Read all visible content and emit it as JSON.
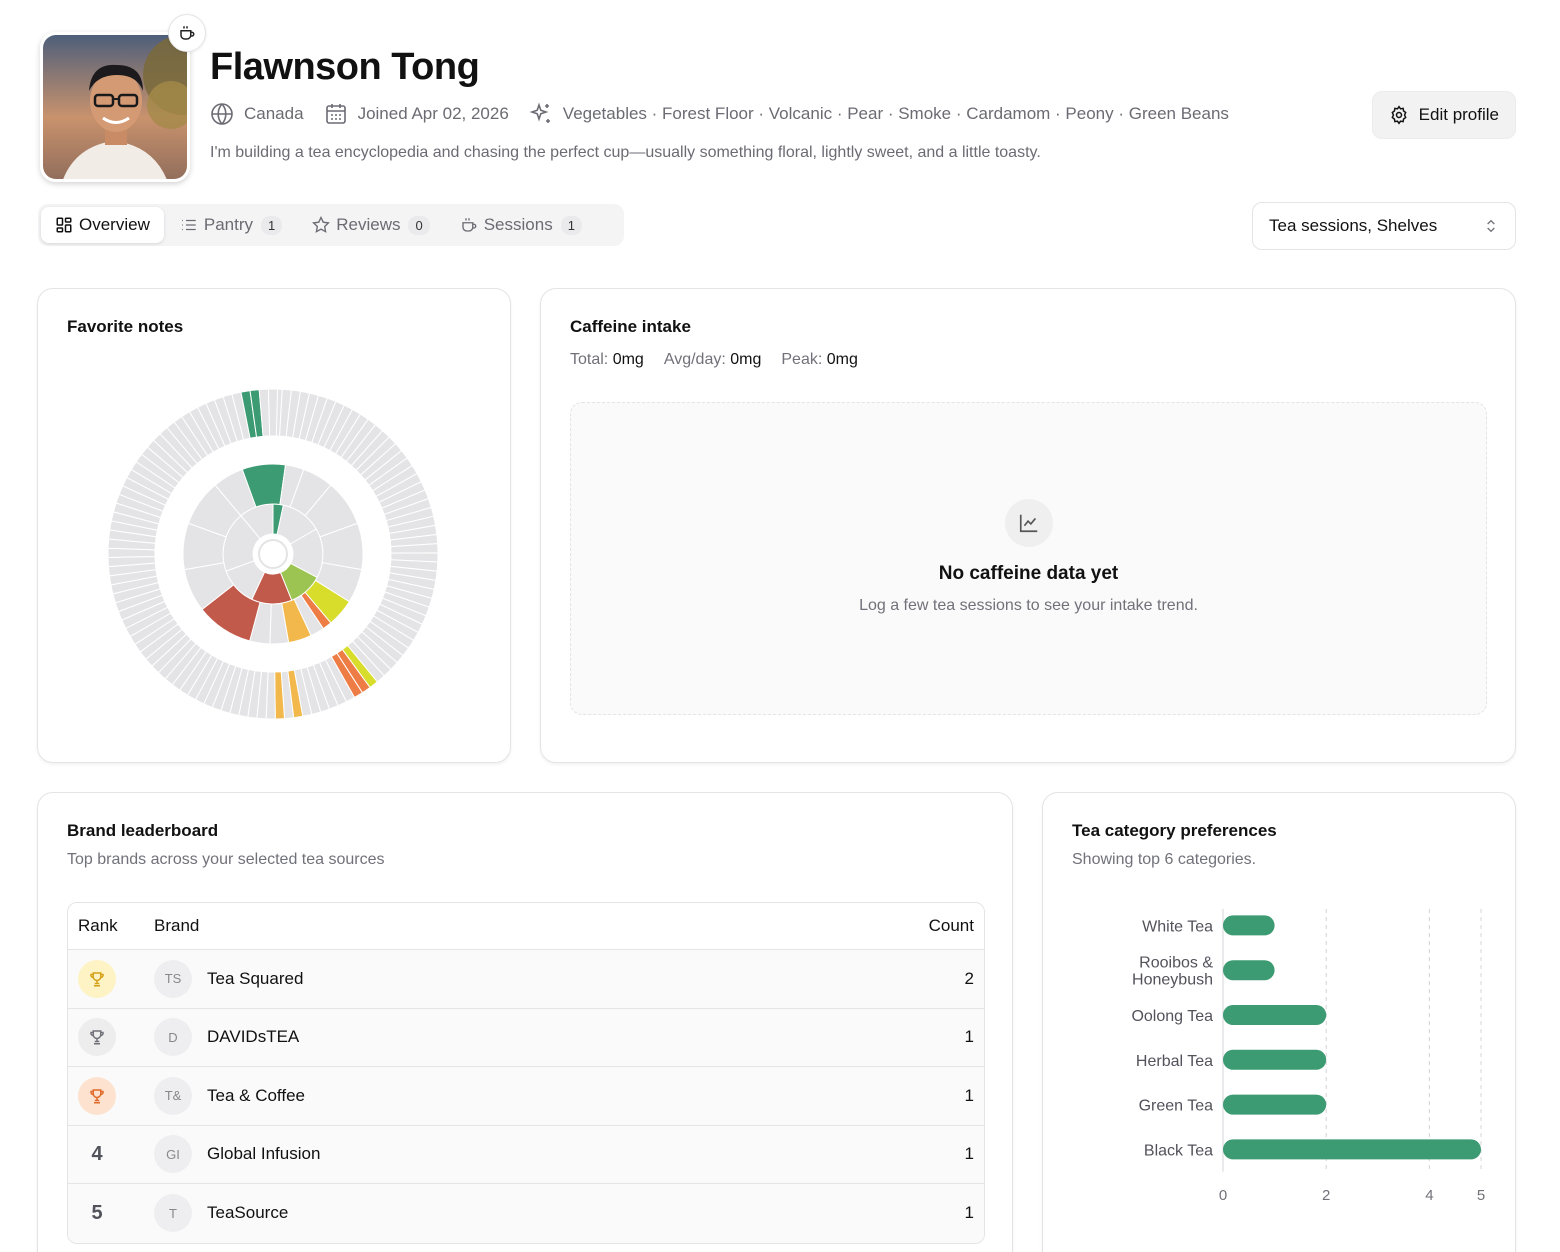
{
  "profile": {
    "name": "Flawnson Tong",
    "location": "Canada",
    "joined": "Joined Apr 02, 2026",
    "notes": "Vegetables · Forest Floor · Volcanic · Pear · Smoke · Cardamom · Peony · Green Beans",
    "bio": "I'm building a tea encyclopedia and chasing the perfect cup—usually something floral, lightly sweet, and a little toasty.",
    "edit_label": "Edit profile",
    "badge_icon": "cup-icon"
  },
  "tabs": [
    {
      "label": "Overview",
      "icon": "grid-icon",
      "count": ""
    },
    {
      "label": "Pantry",
      "icon": "list-icon",
      "count": "1"
    },
    {
      "label": "Reviews",
      "icon": "star-icon",
      "count": "0"
    },
    {
      "label": "Sessions",
      "icon": "cup-icon",
      "count": "1"
    }
  ],
  "source_select": {
    "value": "Tea sessions, Shelves"
  },
  "favorite_notes": {
    "title": "Favorite notes",
    "highlight_colors": [
      "#3d9b73",
      "#c25a4b",
      "#9bc452",
      "#d8dc2a",
      "#f2b84b",
      "#ee7d45"
    ]
  },
  "caffeine": {
    "title": "Caffeine intake",
    "total_label": "Total:",
    "total_value": "0mg",
    "avg_label": "Avg/day:",
    "avg_value": "0mg",
    "peak_label": "Peak:",
    "peak_value": "0mg",
    "empty_title": "No caffeine data yet",
    "empty_sub": "Log a few tea sessions to see your intake trend."
  },
  "brands": {
    "title": "Brand leaderboard",
    "subtitle": "Top brands across your selected tea sources",
    "headers": {
      "rank": "Rank",
      "brand": "Brand",
      "count": "Count"
    },
    "rows": [
      {
        "rank": "1",
        "initials": "TS",
        "name": "Tea Squared",
        "count": "2",
        "medal": "gold"
      },
      {
        "rank": "2",
        "initials": "D",
        "name": "DAVIDsTEA",
        "count": "1",
        "medal": "silver"
      },
      {
        "rank": "3",
        "initials": "T&",
        "name": "Tea & Coffee",
        "count": "1",
        "medal": "bronze"
      },
      {
        "rank": "4",
        "initials": "GI",
        "name": "Global Infusion",
        "count": "1",
        "medal": ""
      },
      {
        "rank": "5",
        "initials": "T",
        "name": "TeaSource",
        "count": "1",
        "medal": ""
      }
    ]
  },
  "categories": {
    "title": "Tea category preferences",
    "subtitle": "Showing top 6 categories."
  },
  "chart_data": {
    "type": "bar",
    "orientation": "horizontal",
    "categories": [
      "White Tea",
      "Rooibos & Honeybush",
      "Oolong Tea",
      "Herbal Tea",
      "Green Tea",
      "Black Tea"
    ],
    "values": [
      1,
      1,
      2,
      2,
      2,
      5
    ],
    "xlim": [
      0,
      5
    ],
    "xticks": [
      0,
      2,
      4,
      5
    ],
    "grid": true,
    "color": "#3d9b73"
  }
}
